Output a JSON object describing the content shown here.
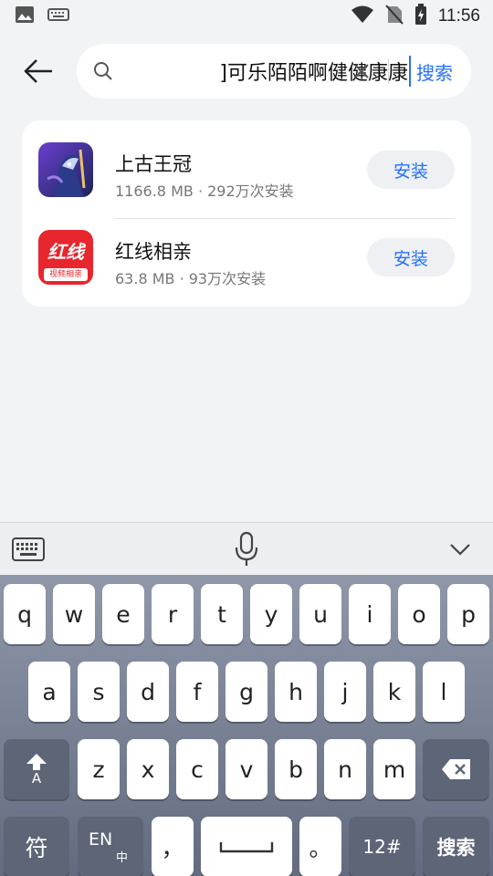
{
  "status_bar": {
    "time": "11:56",
    "left_icons": [
      "image-icon",
      "keyboard-icon"
    ],
    "right_icons": [
      "wifi-icon",
      "no-sim-icon",
      "battery-charging-icon"
    ]
  },
  "search": {
    "query": "]可乐陌陌啊健健康康",
    "button_label": "搜索"
  },
  "results": [
    {
      "name": "上古王冠",
      "meta": "1166.8 MB · 292万次安装",
      "install_label": "安装",
      "icon": "shanggu-wangguan-app-icon"
    },
    {
      "name": "红线相亲",
      "meta": "63.8 MB · 93万次安装",
      "install_label": "安装",
      "icon": "hongxian-xiangqin-app-icon",
      "icon_text": "红线",
      "icon_subtext": "视频相亲"
    }
  ],
  "keyboard": {
    "row1": [
      "q",
      "w",
      "e",
      "r",
      "t",
      "y",
      "u",
      "i",
      "o",
      "p"
    ],
    "row2": [
      "a",
      "s",
      "d",
      "f",
      "g",
      "h",
      "j",
      "k",
      "l"
    ],
    "row3": [
      "z",
      "x",
      "c",
      "v",
      "b",
      "n",
      "m"
    ],
    "shift_label": "A",
    "symbols_label": "符",
    "lang_label": "EN",
    "lang_sub": "中",
    "comma": "，",
    "period": "。",
    "numbers_label": "12#",
    "search_label": "搜索"
  },
  "colors": {
    "accent": "#256fff",
    "background": "#f1f3f5",
    "keyboard_function_key": "#5d6577"
  }
}
